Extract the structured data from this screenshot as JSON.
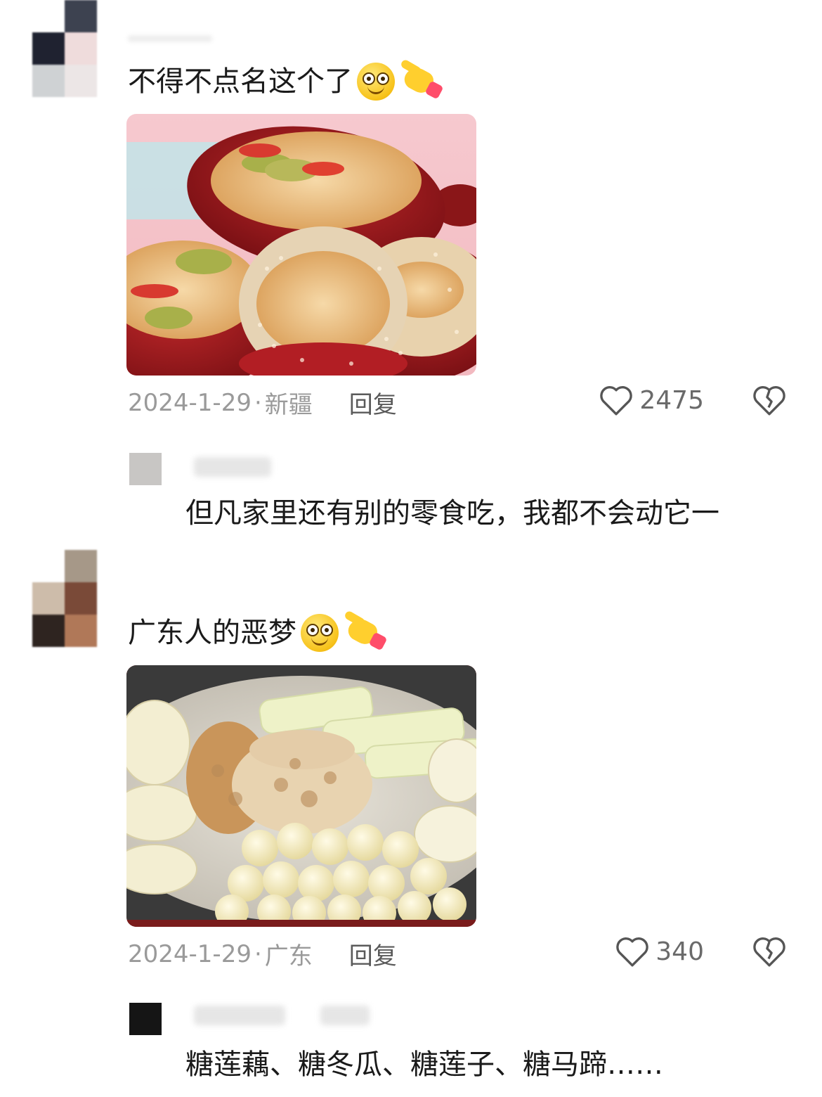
{
  "comments": [
    {
      "text": "不得不点名这个了",
      "emojis": [
        "grinning-face-emoji",
        "pointing-hand-emoji"
      ],
      "photo_desc": "jujube-walnut-snack-photo",
      "date": "2024-1-29",
      "separator": "·",
      "location": "新疆",
      "reply_label": "回复",
      "likes": "2475",
      "sub_reply": {
        "text": "但凡家里还有别的零食吃，我都不会动它一"
      },
      "avatar_colors": [
        "#ffffff",
        "#3d4250",
        "#1f2230",
        "#efdcdc",
        "#cfd2d4",
        "#ece6e6"
      ],
      "sub_avatar_color": "#c8c6c4"
    },
    {
      "text": "广东人的恶梦",
      "emojis": [
        "grinning-face-emoji",
        "pointing-hand-emoji"
      ],
      "photo_desc": "candied-lotus-tray-photo",
      "date": "2024-1-29",
      "separator": "·",
      "location": "广东",
      "reply_label": "回复",
      "likes": "340",
      "sub_reply": {
        "text": "糖莲藕、糖冬瓜、糖莲子、糖马蹄……"
      },
      "avatar_colors": [
        "#ffffff",
        "#a69888",
        "#cdbcaa",
        "#7a4a38",
        "#2e2420",
        "#b07858"
      ],
      "sub_avatar_color": "#151515"
    }
  ],
  "icons": {
    "like": "heart-outline-icon",
    "dislike": "broken-heart-icon"
  }
}
